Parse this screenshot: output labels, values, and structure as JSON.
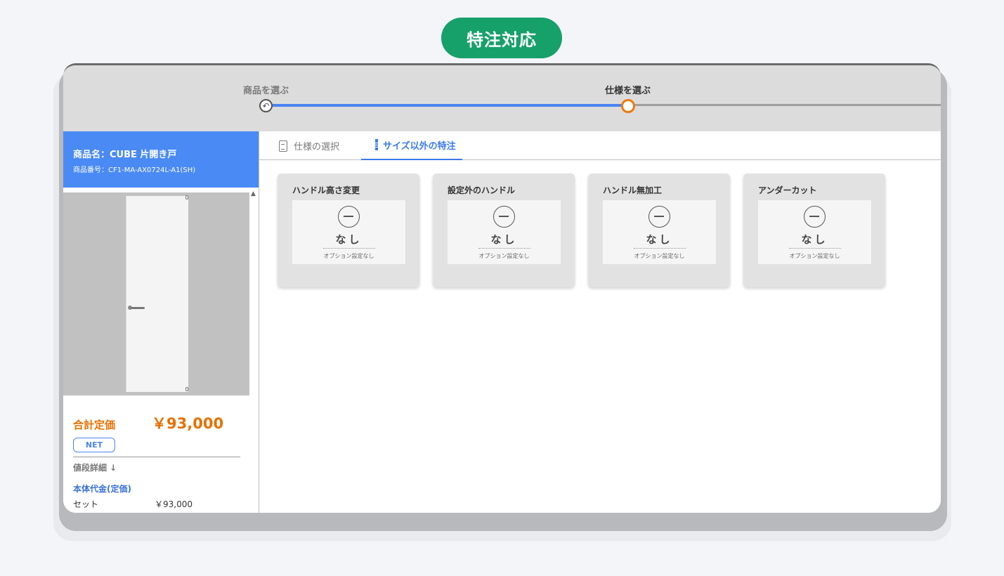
{
  "badge": {
    "label": "特注対応"
  },
  "stepper": {
    "steps": [
      {
        "label": "商品を選ぶ",
        "state": "done"
      },
      {
        "label": "仕様を選ぶ",
        "state": "current"
      }
    ],
    "colors": {
      "done_track": "#4a84f2",
      "current_dot": "#f07a0a"
    },
    "done_icon": "undo-icon"
  },
  "product": {
    "name": "商品名：CUBE 片開き戸",
    "code": "商品番号：CF1-MA-AX0724L-A1(SH)"
  },
  "price": {
    "total_label": "合計定価",
    "total_value": "￥93,000",
    "net_label": "NET",
    "detail_label": "値段詳細 ↓",
    "section_title": "本体代金(定価)",
    "set_label": "セット",
    "set_price": "￥93,000"
  },
  "tabs": [
    {
      "label": "仕様の選択",
      "icon": "clipboard-icon",
      "active": false
    },
    {
      "label": "サイズ以外の特注",
      "icon": "ruler-icon",
      "active": true
    }
  ],
  "options": [
    {
      "title": "ハンドル高さ変更",
      "value": "なし",
      "note": "オプション設定なし"
    },
    {
      "title": "設定外のハンドル",
      "value": "なし",
      "note": "オプション設定なし"
    },
    {
      "title": "ハンドル無加工",
      "value": "なし",
      "note": "オプション設定なし"
    },
    {
      "title": "アンダーカット",
      "value": "なし",
      "note": "オプション設定なし"
    }
  ],
  "colors": {
    "badge": "#16a06a",
    "header": "#4a8af5",
    "price": "#e77000",
    "accent": "#3a7af0"
  }
}
